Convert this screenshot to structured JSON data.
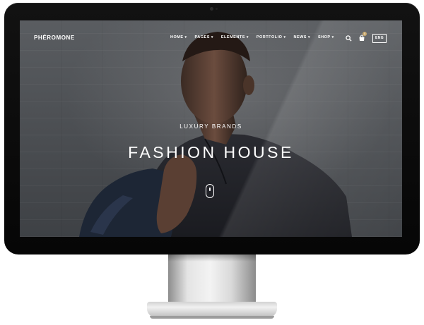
{
  "site": {
    "logo": "PHÉROMONE"
  },
  "nav": {
    "items": [
      {
        "label": "HOME"
      },
      {
        "label": "PAGES"
      },
      {
        "label": "ELEMENTS"
      },
      {
        "label": "PORTFOLIO"
      },
      {
        "label": "NEWS"
      },
      {
        "label": "SHOP"
      }
    ],
    "chevron": "▾"
  },
  "header_icons": {
    "search": "search-icon",
    "cart": "cart-icon",
    "cart_count": "0"
  },
  "language": {
    "label": "ENG"
  },
  "hero": {
    "subtitle": "LUXURY BRANDS",
    "title": "FASHION HOUSE"
  },
  "colors": {
    "accent": "#c9a96e",
    "text": "#ffffff",
    "bezel": "#0b0b0b"
  }
}
